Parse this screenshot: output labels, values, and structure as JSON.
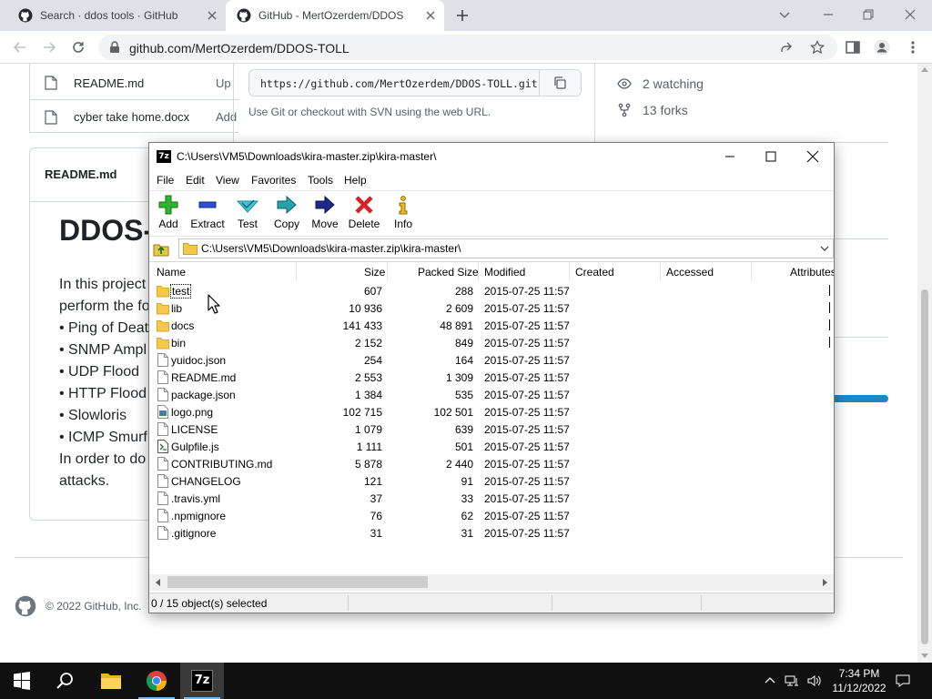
{
  "browser": {
    "tabs": [
      {
        "title": "Search · ddos tools · GitHub"
      },
      {
        "title": "GitHub - MertOzerdem/DDOS-TOLL"
      }
    ],
    "url": "github.com/MertOzerdem/DDOS-TOLL"
  },
  "github": {
    "files": [
      {
        "name": "README.md",
        "commit": "Up"
      },
      {
        "name": "cyber take home.docx",
        "commit": "Add"
      }
    ],
    "clone_url": "https://github.com/MertOzerdem/DDOS-TOLL.git",
    "clone_hint": "Use Git or checkout with SVN using the web URL.",
    "watching": "2 watching",
    "forks": "13 forks",
    "readme_header": "README.md",
    "readme_title": "DDOS-",
    "readme_lines": [
      "In this project",
      "perform the fo",
      "• Ping of Deat",
      "• SNMP Ampl",
      "• UDP Flood",
      "• HTTP Flood",
      "• Slowloris",
      "• ICMP Smurf",
      "In order to do",
      "attacks."
    ],
    "footer": "© 2022 GitHub, Inc."
  },
  "zip": {
    "title": "C:\\Users\\VM5\\Downloads\\kira-master.zip\\kira-master\\",
    "menu": [
      "File",
      "Edit",
      "View",
      "Favorites",
      "Tools",
      "Help"
    ],
    "toolbar": [
      "Add",
      "Extract",
      "Test",
      "Copy",
      "Move",
      "Delete",
      "Info"
    ],
    "path": "C:\\Users\\VM5\\Downloads\\kira-master.zip\\kira-master\\",
    "columns": [
      "Name",
      "Size",
      "Packed Size",
      "Modified",
      "Created",
      "Accessed",
      "Attributes"
    ],
    "rows": [
      {
        "name": "test",
        "size": "607",
        "packed": "288",
        "modified": "2015-07-25 11:57",
        "type": "folder"
      },
      {
        "name": "lib",
        "size": "10 936",
        "packed": "2 609",
        "modified": "2015-07-25 11:57",
        "type": "folder"
      },
      {
        "name": "docs",
        "size": "141 433",
        "packed": "48 891",
        "modified": "2015-07-25 11:57",
        "type": "folder"
      },
      {
        "name": "bin",
        "size": "2 152",
        "packed": "849",
        "modified": "2015-07-25 11:57",
        "type": "folder"
      },
      {
        "name": "yuidoc.json",
        "size": "254",
        "packed": "164",
        "modified": "2015-07-25 11:57",
        "type": "file"
      },
      {
        "name": "README.md",
        "size": "2 553",
        "packed": "1 309",
        "modified": "2015-07-25 11:57",
        "type": "file"
      },
      {
        "name": "package.json",
        "size": "1 384",
        "packed": "535",
        "modified": "2015-07-25 11:57",
        "type": "file"
      },
      {
        "name": "logo.png",
        "size": "102 715",
        "packed": "102 501",
        "modified": "2015-07-25 11:57",
        "type": "image"
      },
      {
        "name": "LICENSE",
        "size": "1 079",
        "packed": "639",
        "modified": "2015-07-25 11:57",
        "type": "file"
      },
      {
        "name": "Gulpfile.js",
        "size": "1 111",
        "packed": "501",
        "modified": "2015-07-25 11:57",
        "type": "script"
      },
      {
        "name": "CONTRIBUTING.md",
        "size": "5 878",
        "packed": "2 440",
        "modified": "2015-07-25 11:57",
        "type": "file"
      },
      {
        "name": "CHANGELOG",
        "size": "121",
        "packed": "91",
        "modified": "2015-07-25 11:57",
        "type": "file"
      },
      {
        "name": ".travis.yml",
        "size": "37",
        "packed": "33",
        "modified": "2015-07-25 11:57",
        "type": "file"
      },
      {
        "name": ".npmignore",
        "size": "76",
        "packed": "62",
        "modified": "2015-07-25 11:57",
        "type": "file"
      },
      {
        "name": ".gitignore",
        "size": "31",
        "packed": "31",
        "modified": "2015-07-25 11:57",
        "type": "file"
      }
    ],
    "status": "0 / 15 object(s) selected"
  },
  "taskbar": {
    "time": "7:34 PM",
    "date": "11/12/2022",
    "apps": [
      "windows-start",
      "search",
      "file-explorer",
      "chrome",
      "7-zip"
    ]
  },
  "colors": {
    "accent_folder": "#f5c84c",
    "github_link": "#0969da",
    "lang_bar": "#1e88c7"
  }
}
